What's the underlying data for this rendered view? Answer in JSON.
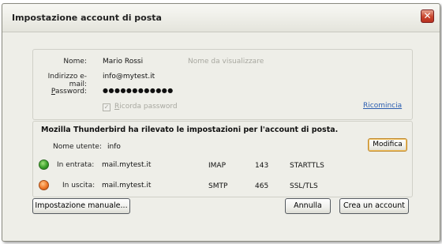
{
  "window": {
    "title": "Impostazione account di posta",
    "close_glyph": "✕"
  },
  "credentials": {
    "name_label": "Nome:",
    "name_value": "Mario Rossi",
    "name_hint": "Nome da visualizzare",
    "email_label": "Indirizzo e-mail:",
    "email_value": "info@mytest.it",
    "password_label": "Password:",
    "password_value": "●●●●●●●●●●●●",
    "remember_label": "Ricorda password",
    "remember_checked": true,
    "restart_link": "Ricomincia"
  },
  "detected": {
    "heading": "Mozilla Thunderbird ha rilevato le impostazioni per l'account di posta.",
    "username_label": "Nome utente:",
    "username_value": "info",
    "modify_button": "Modifica",
    "incoming": {
      "label": "In entrata:",
      "server": "mail.mytest.it",
      "protocol": "IMAP",
      "port": "143",
      "security": "STARTTLS",
      "status_color": "#3aa02a"
    },
    "outgoing": {
      "label": "In uscita:",
      "server": "mail.mytest.it",
      "protocol": "SMTP",
      "port": "465",
      "security": "SSL/TLS",
      "status_color": "#f07828"
    }
  },
  "footer": {
    "manual_button": "Impostazione manuale...",
    "cancel_button": "Annulla",
    "create_button": "Crea un account"
  }
}
